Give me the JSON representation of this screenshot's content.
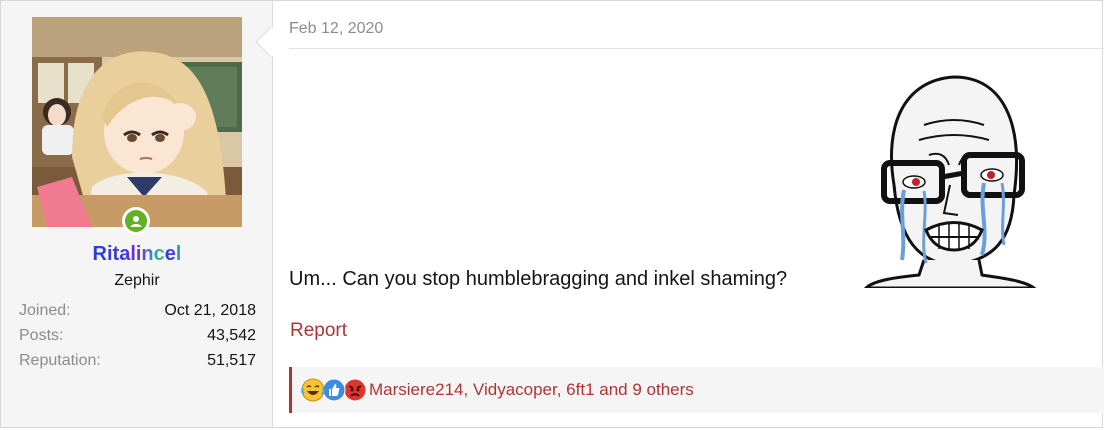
{
  "user": {
    "username": "Ritalincel",
    "username_part1": "Ritalinc",
    "username_part2": "el",
    "user_title": "Zephir",
    "online_status": "online",
    "stats": [
      {
        "label": "Joined:",
        "value": "Oct 21, 2018"
      },
      {
        "label": "Posts:",
        "value": "43,542"
      },
      {
        "label": "Reputation:",
        "value": "51,517"
      }
    ]
  },
  "post": {
    "date": "Feb 12, 2020",
    "message": "Um... Can you stop humblebragging and inkel shaming?",
    "report_label": "Report",
    "reactions": {
      "icons": [
        "laughing-crying-icon",
        "thumbs-up-icon",
        "angry-icon"
      ],
      "text": "Marsiere214, Vidyacoper, 6ft1 and 9 others"
    }
  },
  "colors": {
    "accent": "#b03434",
    "muted_text": "#8c8c8c",
    "panel_bg": "#f5f5f5",
    "online": "#63b027"
  }
}
